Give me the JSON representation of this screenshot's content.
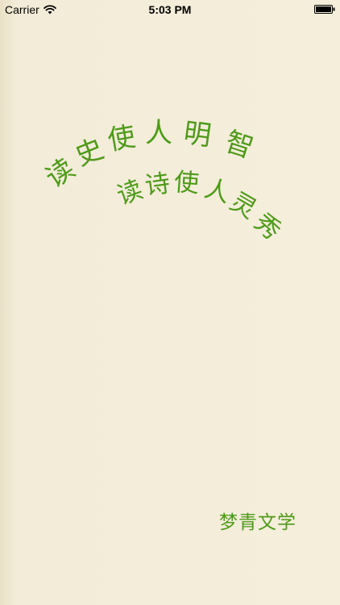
{
  "status_bar": {
    "carrier": "Carrier",
    "time": "5:03 PM",
    "wifi_icon": "wifi-icon",
    "battery_icon": "battery-icon"
  },
  "headline_1": {
    "chars": [
      "读",
      "史",
      "使",
      "人",
      "明",
      "智"
    ]
  },
  "headline_2": {
    "chars": [
      "读",
      "诗",
      "使",
      "人",
      "灵",
      "秀"
    ]
  },
  "brand": "梦青文学",
  "colors": {
    "text_green": "#4e9a1a",
    "background": "#f3ecd8"
  }
}
